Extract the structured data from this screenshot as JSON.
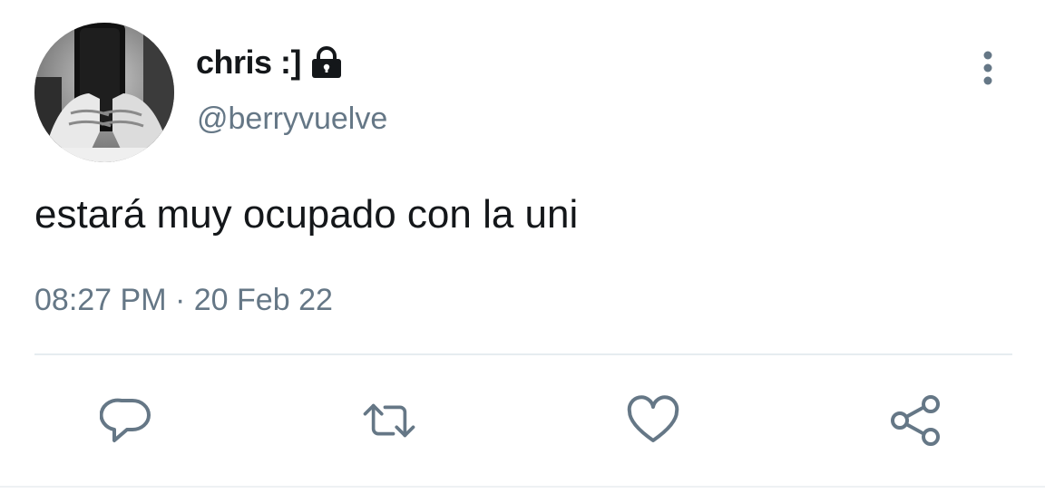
{
  "tweet": {
    "author": {
      "display_name": "chris :]",
      "handle": "@berryvuelve",
      "protected_icon": "lock-icon"
    },
    "text": "estará muy ocupado con la uni",
    "time": "08:27 PM",
    "separator": "·",
    "date": "20 Feb 22"
  },
  "actions": {
    "more": "vertical-dots-icon",
    "reply": "reply-icon",
    "retweet": "retweet-icon",
    "like": "heart-icon",
    "share": "share-icon"
  },
  "colors": {
    "text_primary": "#14171a",
    "text_secondary": "#657786",
    "divider": "#e6ecf0"
  }
}
